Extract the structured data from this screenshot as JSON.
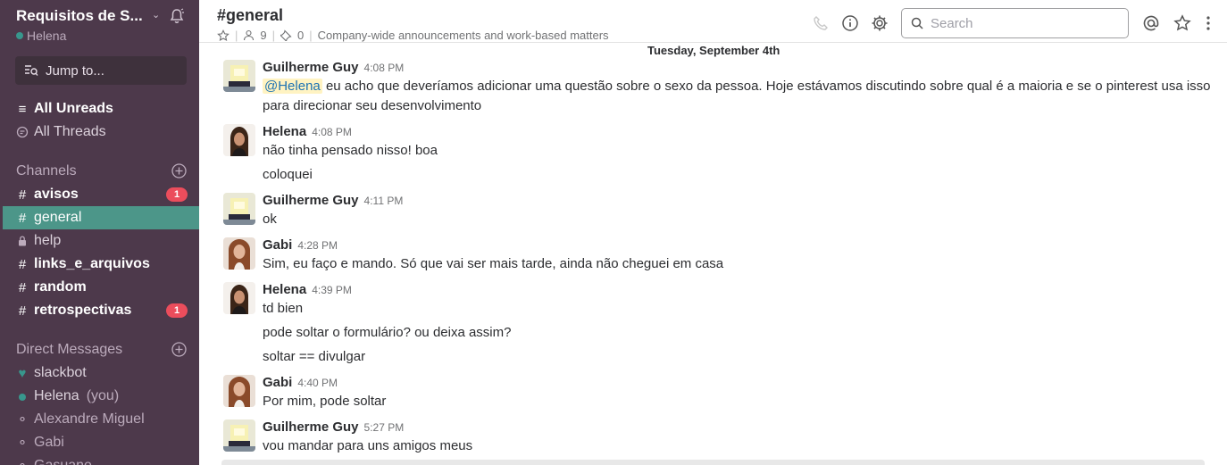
{
  "team": {
    "name": "Requisitos de S...",
    "user": "Helena"
  },
  "jump": {
    "label": "Jump to..."
  },
  "nav": {
    "all_unreads": "All Unreads",
    "all_threads": "All Threads"
  },
  "channels": {
    "title": "Channels",
    "items": [
      {
        "name": "avisos",
        "badge": "1"
      },
      {
        "name": "general"
      },
      {
        "name": "help"
      },
      {
        "name": "links_e_arquivos"
      },
      {
        "name": "random"
      },
      {
        "name": "retrospectivas",
        "badge": "1"
      }
    ]
  },
  "dms": {
    "title": "Direct Messages",
    "items": [
      {
        "name": "slackbot"
      },
      {
        "name": "Helena",
        "suffix": "(you)"
      },
      {
        "name": "Alexandre Miguel"
      },
      {
        "name": "Gabi"
      },
      {
        "name": "Gasuane"
      }
    ]
  },
  "header": {
    "channel": "#general",
    "members": "9",
    "pins": "0",
    "topic": "Company-wide announcements and work-based matters",
    "search_placeholder": "Search"
  },
  "date_divider": "Tuesday, September 4th",
  "messages": [
    {
      "author": "Guilherme Guy",
      "time": "4:08 PM",
      "mention": "@Helena",
      "lines": [
        "eu acho que deveríamos adicionar uma questão sobre o sexo da pessoa. Hoje estávamos discutindo sobre qual é a maioria e se o pinterest usa isso para direcionar seu desenvolvimento"
      ]
    },
    {
      "author": "Helena",
      "time": "4:08 PM",
      "lines": [
        "não tinha pensado nisso! boa",
        "coloquei"
      ]
    },
    {
      "author": "Guilherme Guy",
      "time": "4:11 PM",
      "lines": [
        "ok"
      ]
    },
    {
      "author": "Gabi",
      "time": "4:28 PM",
      "lines": [
        "Sim, eu faço e mando. Só que vai ser mais tarde, ainda não cheguei em casa"
      ]
    },
    {
      "author": "Helena",
      "time": "4:39 PM",
      "lines": [
        "td bien",
        "pode soltar o formulário? ou deixa assim?",
        "soltar == divulgar"
      ]
    },
    {
      "author": "Gabi",
      "time": "4:40 PM",
      "lines": [
        "Por mim, pode soltar"
      ]
    },
    {
      "author": "Guilherme Guy",
      "time": "5:27 PM",
      "lines": [
        "vou mandar para uns amigos meus"
      ]
    }
  ],
  "colors": {
    "sidebar": "#4d394b",
    "active_channel": "#4c9689",
    "badge": "#eb4d5c",
    "presence": "#38978d"
  }
}
